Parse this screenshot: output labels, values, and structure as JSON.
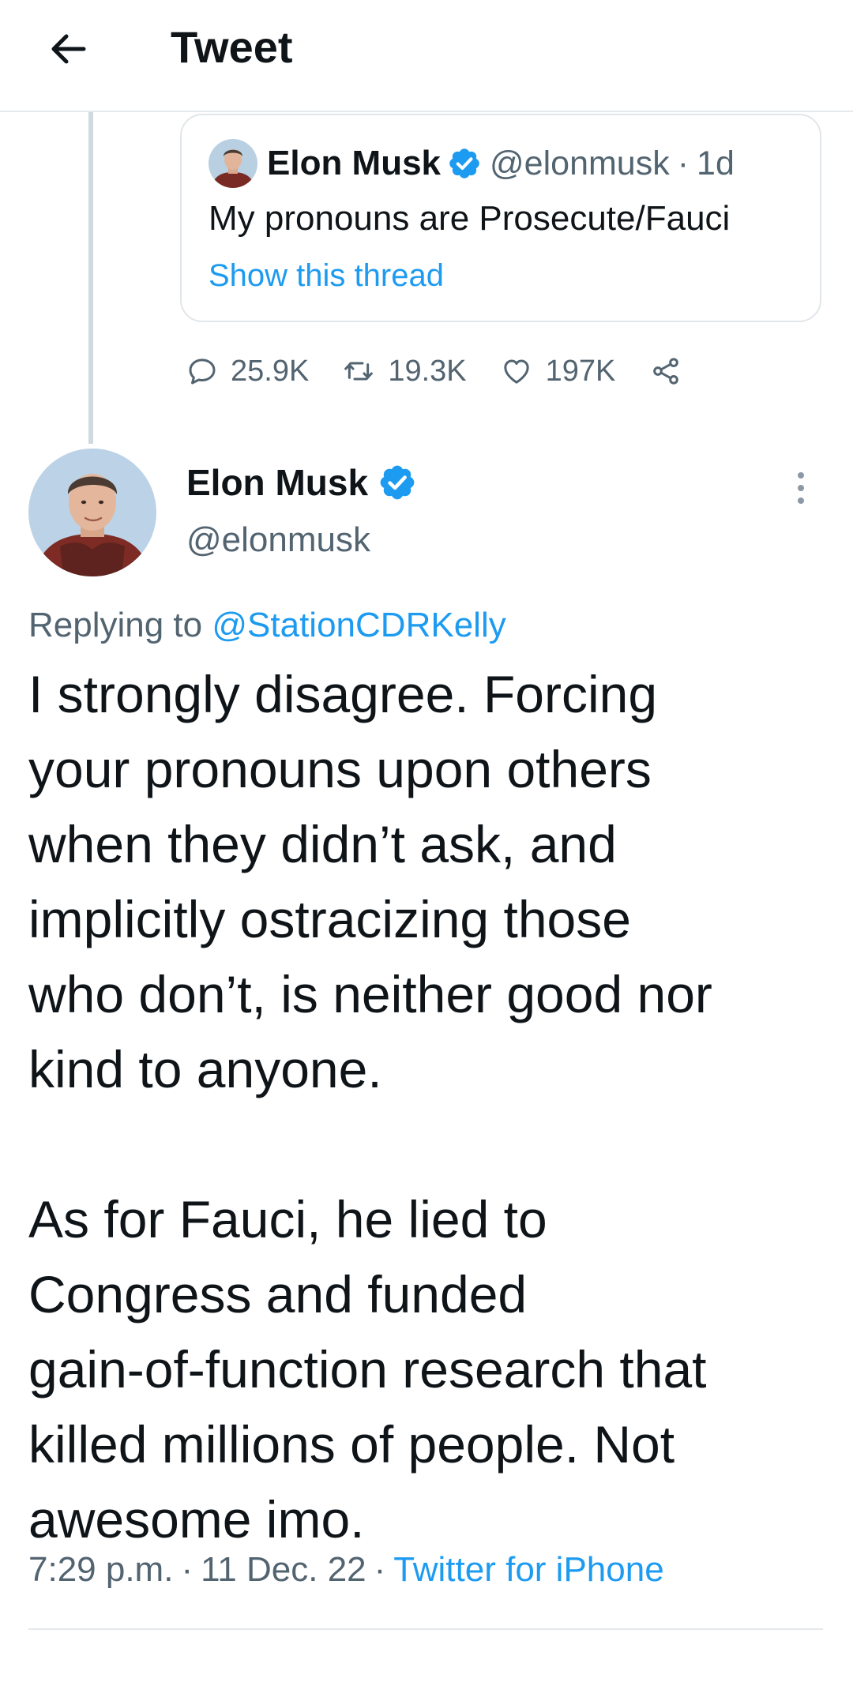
{
  "header": {
    "title": "Tweet",
    "back_icon": "arrow-left-icon"
  },
  "quoted_tweet": {
    "name": "Elon Musk",
    "handle": "@elonmusk",
    "separator": "·",
    "time": "1d",
    "text": "My pronouns are Prosecute/Fauci",
    "show_thread": "Show this thread",
    "actions": {
      "replies": "25.9K",
      "retweets": "19.3K",
      "likes": "197K"
    }
  },
  "main_tweet": {
    "name": "Elon Musk",
    "handle": "@elonmusk",
    "replying_prefix": "Replying to",
    "replying_to": "@StationCDRKelly",
    "paragraph1": "I strongly disagree. Forcing\nyour pronouns upon others\nwhen they didn’t ask, and\nimplicitly ostracizing those\nwho don’t, is neither good nor\nkind to anyone.",
    "paragraph2": "As for Fauci, he lied to\nCongress and funded\ngain-of-function research that\nkilled millions of people. Not\nawesome imo.",
    "time": "7:29 p.m.",
    "date": "11 Dec. 22",
    "separator": "·",
    "source": "Twitter for iPhone"
  },
  "colors": {
    "accent": "#1d9bf0",
    "text": "#0f1419",
    "secondary": "#536471",
    "border": "#e1e6ea"
  }
}
